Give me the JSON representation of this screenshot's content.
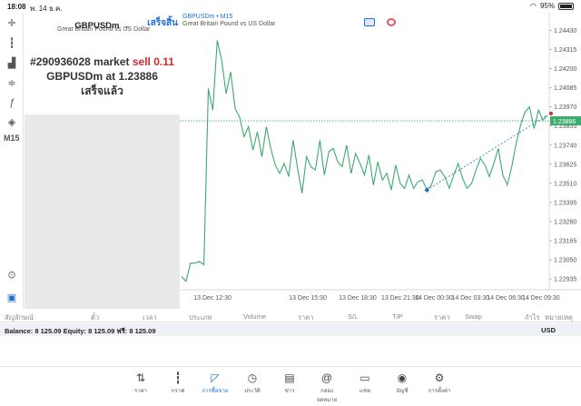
{
  "status": {
    "time": "18:08",
    "date": "พ. 14 ธ.ค.",
    "battery": "95%"
  },
  "toolbar": {
    "items": [
      "crosshair-icon",
      "candles-icon",
      "bar-chart-icon",
      "indicators-icon",
      "function-icon",
      "objects-icon"
    ],
    "timeframe": "M15",
    "bottom_items": [
      "search-chart-icon",
      "trade-icon"
    ]
  },
  "trade_panel": {
    "symbol": "GBPUSDm",
    "description": "Great Britain Pound vs US Dollar",
    "done_label": "เสร็จสิ้น",
    "order_line1_prefix": "#290936028 market",
    "order_line1_action": "sell 0.11",
    "order_line2_prefix": "GBPUSDm at",
    "order_line2_price": "1.23886",
    "order_line3": "เสร็จแล้ว"
  },
  "chart_header": {
    "title": "GBPUSDm • M15",
    "description": "Great Britain Pound vs US Dollar"
  },
  "chart_data": {
    "type": "line",
    "title": "",
    "ylim": [
      1.2287,
      1.2446
    ],
    "y_ticks": [
      "1.24430",
      "1.24315",
      "1.24200",
      "1.24085",
      "1.23970",
      "1.23855",
      "1.23740",
      "1.23625",
      "1.23510",
      "1.23395",
      "1.23280",
      "1.23165",
      "1.23050",
      "1.22935"
    ],
    "x_ticks": [
      "13 Dec 12:30",
      "13 Dec 15:30",
      "13 Dec 18:30",
      "13 Dec 21:30",
      "14 Dec 00:30",
      "14 Dec 03:30",
      "14 Dec 06:30",
      "14 Dec 09:30"
    ],
    "current_price": "1.23886",
    "series": [
      {
        "values": [
          1.2295,
          1.2292,
          1.2303,
          1.2303,
          1.2304,
          1.2302,
          1.2408,
          1.2395,
          1.2437,
          1.2425,
          1.2405,
          1.2418,
          1.2396,
          1.2391,
          1.2379,
          1.2385,
          1.2371,
          1.2382,
          1.2367,
          1.2385,
          1.2372,
          1.2362,
          1.2357,
          1.2363,
          1.2355,
          1.2377,
          1.236,
          1.2345,
          1.2367,
          1.2361,
          1.2359,
          1.2377,
          1.2356,
          1.237,
          1.2372,
          1.2364,
          1.2361,
          1.2374,
          1.2357,
          1.2369,
          1.2363,
          1.2356,
          1.2368,
          1.235,
          1.2364,
          1.2353,
          1.2357,
          1.2347,
          1.2362,
          1.2351,
          1.2348,
          1.2356,
          1.2348,
          1.2352,
          1.2353,
          1.2347,
          1.235,
          1.2358,
          1.2359,
          1.2355,
          1.2348,
          1.2356,
          1.2363,
          1.2354,
          1.2348,
          1.2351,
          1.2359,
          1.2366,
          1.2362,
          1.2355,
          1.2363,
          1.2372,
          1.2356,
          1.235,
          1.2361,
          1.2375,
          1.2386,
          1.2394,
          1.2397,
          1.2384,
          1.2395,
          1.2389,
          1.2392
        ]
      }
    ]
  },
  "positions_header": [
    "สัญลักษณ์",
    "ตั๋ว",
    "เวลา",
    "ประเภท",
    "Volume",
    "ราคา",
    "S/L",
    "T/P",
    "ราคา",
    "Swap",
    "กำไร",
    "หมายเหตุ"
  ],
  "balance": {
    "text": "Balance: 8 125.09 Equity: 8 125.09 ฟรี: 8 125.09",
    "currency": "USD"
  },
  "tabs": [
    {
      "icon": "quotes-icon",
      "label": "ราคา"
    },
    {
      "icon": "chart-icon",
      "label": "กราฟ"
    },
    {
      "icon": "trade-icon",
      "label": "การซื้อขาย"
    },
    {
      "icon": "history-icon",
      "label": "ประวัติ"
    },
    {
      "icon": "news-icon",
      "label": "ข่าว"
    },
    {
      "icon": "mailbox-icon",
      "label": "กล่องจดหมาย"
    },
    {
      "icon": "chat-icon",
      "label": "แชท"
    },
    {
      "icon": "account-icon",
      "label": "บัญชี"
    },
    {
      "icon": "settings-icon",
      "label": "การตั้งค่า"
    }
  ],
  "colors": {
    "accent": "#1f6fd1",
    "line": "#3daa6e",
    "sell": "#d62b2b"
  }
}
